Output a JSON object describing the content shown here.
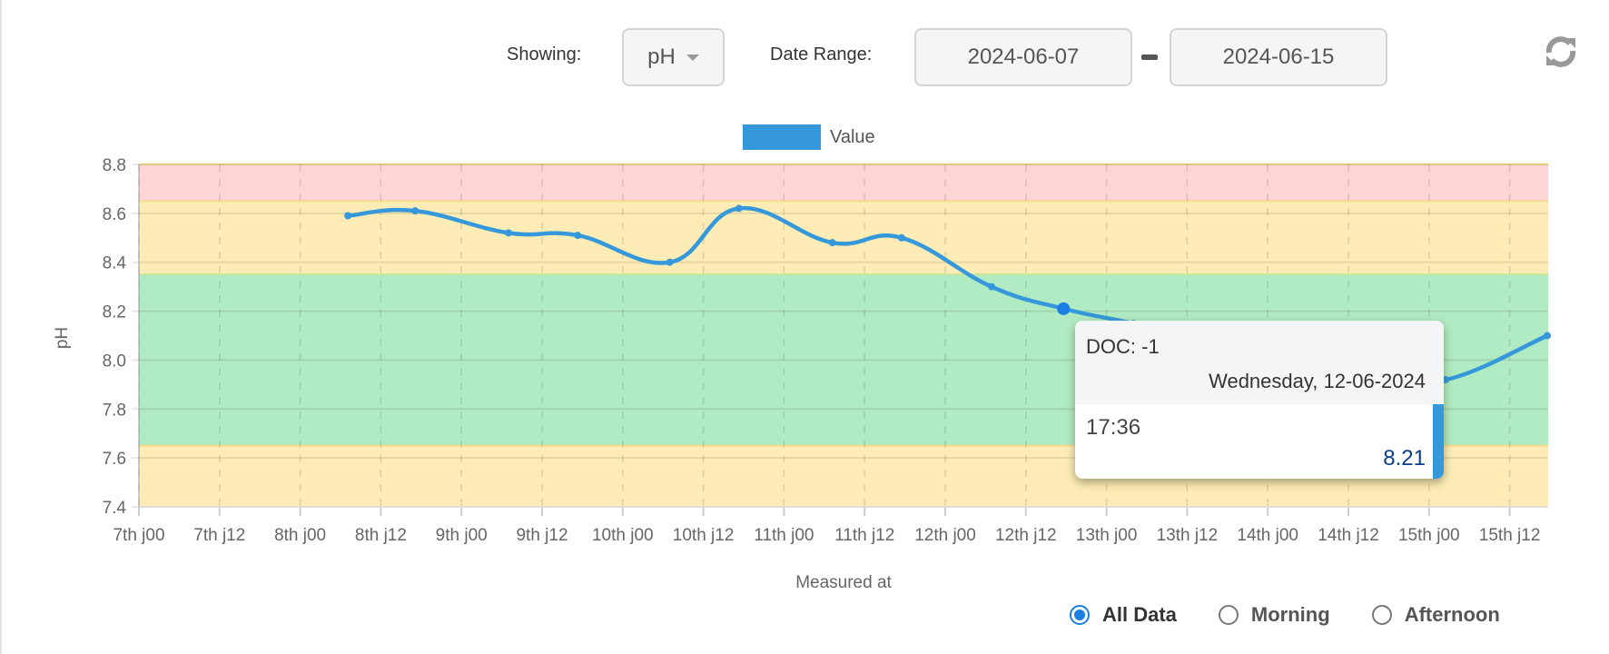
{
  "controls": {
    "showing_label": "Showing:",
    "showing_value": "pH",
    "date_range_label": "Date Range:",
    "date_from": "2024-06-07",
    "date_to": "2024-06-15",
    "refresh_icon": "refresh-icon"
  },
  "filters": [
    {
      "label": "All Data",
      "selected": true
    },
    {
      "label": "Morning",
      "selected": false
    },
    {
      "label": "Afternoon",
      "selected": false
    }
  ],
  "tooltip": {
    "title": "DOC: -1",
    "date": "Wednesday, 12-06-2024",
    "time": "17:36",
    "value": "8.21"
  },
  "chart_data": {
    "type": "line",
    "xlabel": "Measured at",
    "ylabel": "pH",
    "ylim": [
      7.4,
      8.8
    ],
    "yticks": [
      "8.8",
      "8.6",
      "8.4",
      "8.2",
      "8.0",
      "7.8",
      "7.6",
      "7.4"
    ],
    "xlim": [
      "2024-06-07 00:00",
      "2024-06-15 17:36"
    ],
    "xticks": [
      "7th j00",
      "7th j12",
      "8th j00",
      "8th j12",
      "9th j00",
      "9th j12",
      "10th j00",
      "10th j12",
      "11th j00",
      "11th j12",
      "12th j00",
      "12th j12",
      "13th j00",
      "13th j12",
      "14th j00",
      "14th j12",
      "15th j00",
      "15th j12"
    ],
    "grid": true,
    "legend": "top-center",
    "series": [
      {
        "name": "Value",
        "color": "#3498db",
        "points": [
          {
            "x": "2024-06-08 07:06",
            "y": 8.59
          },
          {
            "x": "2024-06-08 17:06",
            "y": 8.61
          },
          {
            "x": "2024-06-09 07:00",
            "y": 8.52
          },
          {
            "x": "2024-06-09 17:18",
            "y": 8.51
          },
          {
            "x": "2024-06-10 07:00",
            "y": 8.4
          },
          {
            "x": "2024-06-10 17:18",
            "y": 8.62
          },
          {
            "x": "2024-06-11 07:12",
            "y": 8.48
          },
          {
            "x": "2024-06-11 17:30",
            "y": 8.5
          },
          {
            "x": "2024-06-12 06:54",
            "y": 8.3
          },
          {
            "x": "2024-06-12 17:36",
            "y": 8.21
          },
          {
            "x": "2024-06-13 04:00",
            "y": 8.15
          },
          {
            "x": "2024-06-13 17:00",
            "y": 8.07
          },
          {
            "x": "2024-06-14 07:00",
            "y": 8.01
          },
          {
            "x": "2024-06-14 17:00",
            "y": 7.96
          },
          {
            "x": "2024-06-15 02:30",
            "y": 7.92
          },
          {
            "x": "2024-06-15 17:36",
            "y": 8.1
          }
        ]
      }
    ],
    "bands": [
      {
        "from": 8.65,
        "to": 8.8,
        "color": "#fdd5d7"
      },
      {
        "from": 8.35,
        "to": 8.65,
        "color": "#fdecb5"
      },
      {
        "from": 7.65,
        "to": 8.35,
        "color": "#b1ebc3"
      },
      {
        "from": 7.4,
        "to": 7.65,
        "color": "#fdecb5"
      }
    ],
    "highlighted": "2024-06-12 17:36"
  }
}
